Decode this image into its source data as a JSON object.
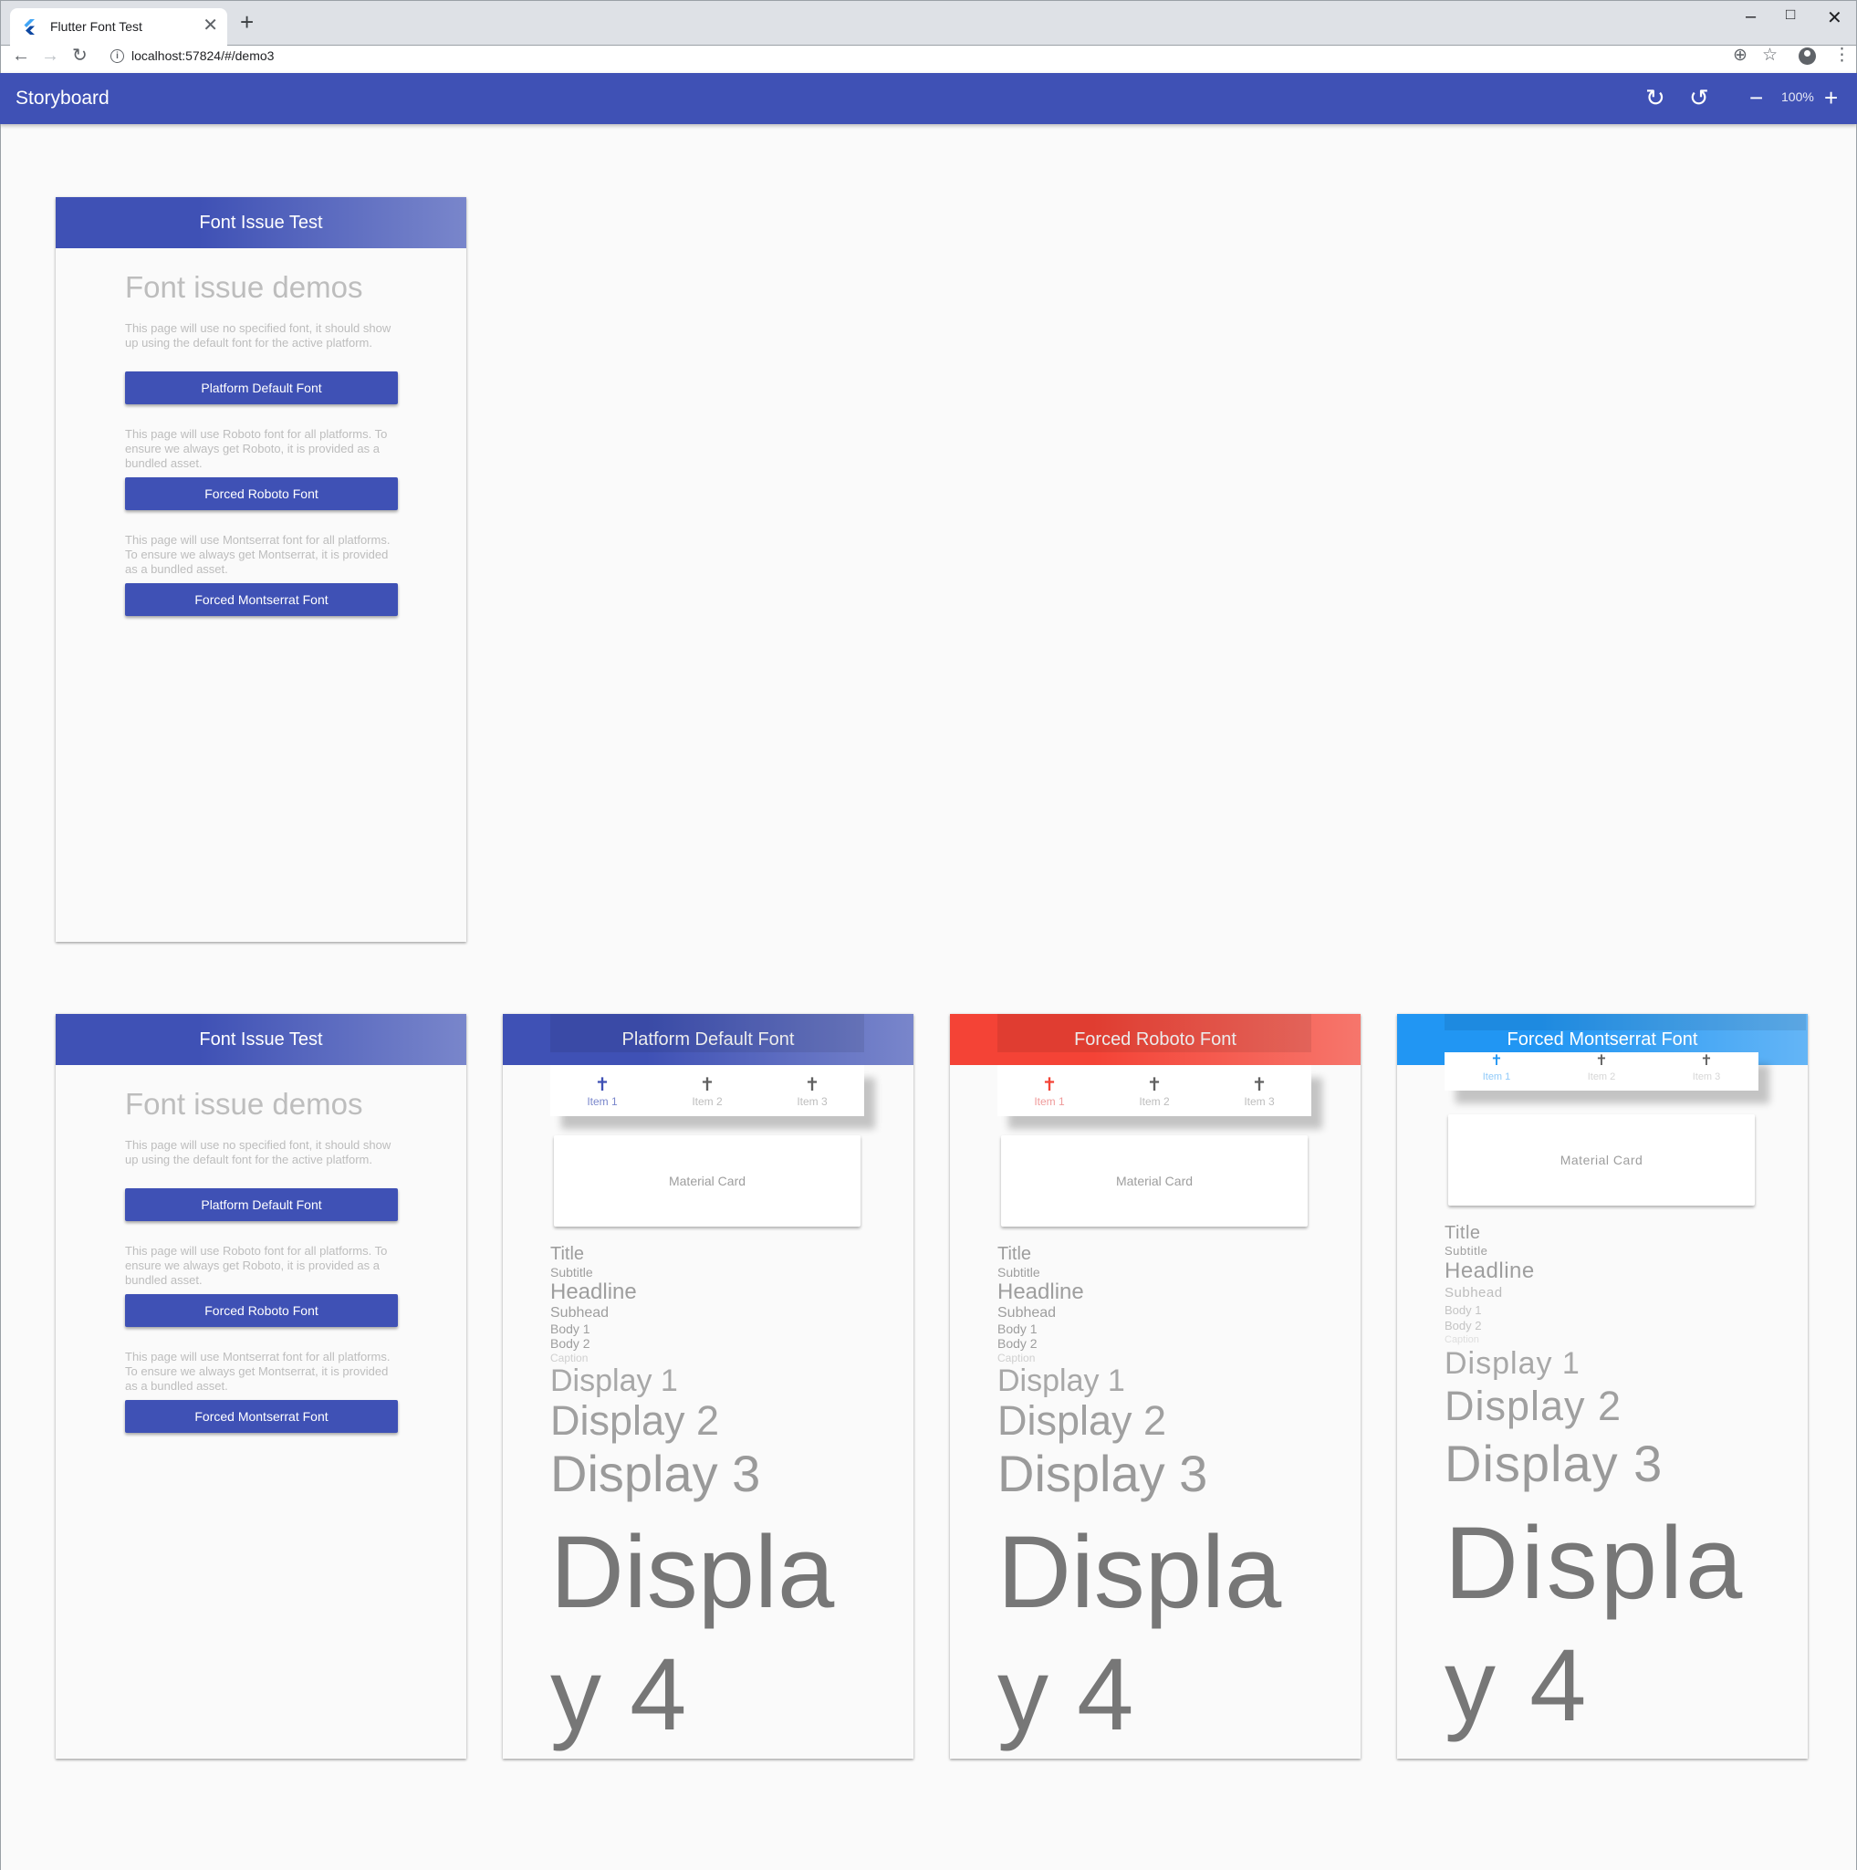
{
  "browser": {
    "tab_title": "Flutter Font Test",
    "url": "localhost:57824/#/demo3",
    "new_tab": "+",
    "close": "✕"
  },
  "storyboard": {
    "title": "Storyboard",
    "zoom": "100%"
  },
  "home": {
    "header": "Font Issue Test",
    "title": "Font issue demos",
    "default_desc": "This page will use no specified font, it should show up using the default font for the active platform.",
    "default_button": "Platform Default Font",
    "roboto_desc": "This page will use Roboto font for all platforms. To ensure we always get Roboto, it is provided as a bundled asset.",
    "roboto_button": "Forced Roboto Font",
    "montserrat_desc": "This page will use Montserrat font for all platforms. To ensure we always get Montserrat, it is provided as a bundled asset.",
    "montserrat_button": "Forced Montserrat Font"
  },
  "demo_common": {
    "nav_items": [
      "Item 1",
      "Item 2",
      "Item 3"
    ],
    "card": "Material Card",
    "typography": {
      "title": "Title",
      "subtitle": "Subtitle",
      "headline": "Headline",
      "subhead": "Subhead",
      "body1": "Body 1",
      "body2": "Body 2",
      "caption": "Caption",
      "display1": "Display 1",
      "display2": "Display 2",
      "display3": "Display 3",
      "display4": "Display 4"
    }
  },
  "demos": [
    {
      "header": "Platform Default Font",
      "accent": "#3f51b5"
    },
    {
      "header": "Forced Roboto Font",
      "accent": "#f44336"
    },
    {
      "header": "Forced Montserrat Font",
      "accent": "#2196f3"
    }
  ]
}
